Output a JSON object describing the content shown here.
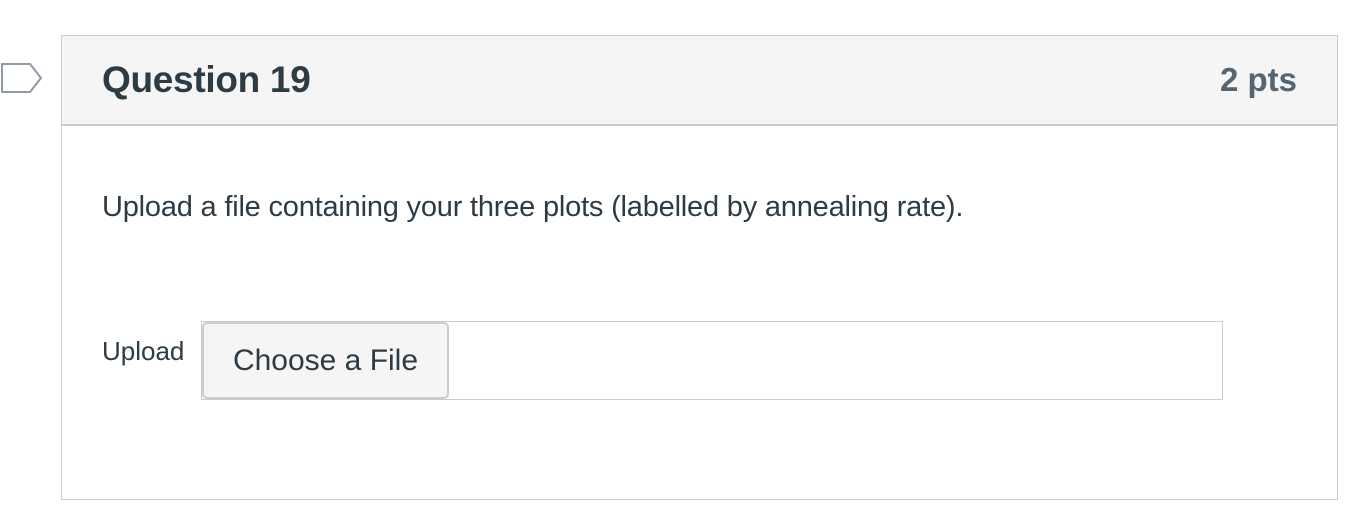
{
  "question": {
    "title": "Question 19",
    "points": "2 pts",
    "text": "Upload a file containing your three plots (labelled by annealing rate).",
    "bookmark_icon": "bookmark-flag-icon"
  },
  "upload": {
    "label": "Upload",
    "button_label": "Choose a File",
    "file_name": ""
  },
  "colors": {
    "text": "#2d3b45",
    "points": "#556572",
    "border": "#c7cdd1",
    "header_bg": "#f5f5f5"
  }
}
